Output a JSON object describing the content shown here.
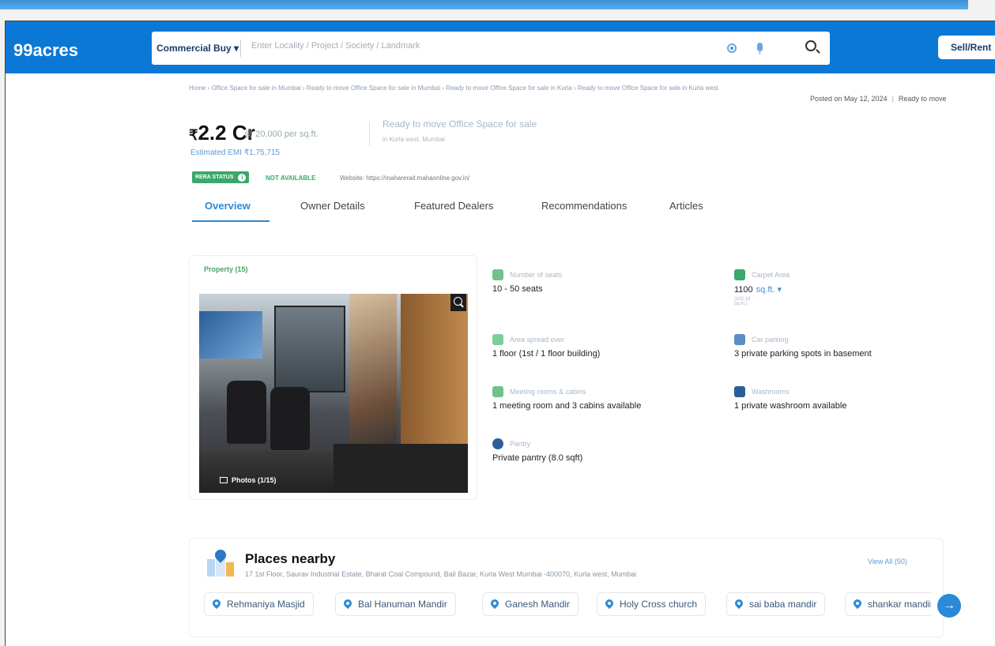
{
  "header": {
    "logo": "99acres",
    "category": "Commercial Buy ▾",
    "search_placeholder": "Enter Locality / Project / Society / Landmark",
    "sell_rent": "Sell/Rent"
  },
  "breadcrumb": "Home › Office Space for sale in Mumbai › Ready to move Office Space for sale in Mumbai › Ready to move Office Space for sale in Kurla › Ready to move Office Space for sale in Kurla west",
  "posted": {
    "date": "Posted on May 12, 2024",
    "status": "Ready to move"
  },
  "price": {
    "symbol": "₹",
    "amount": "2.2 Cr",
    "per_sqft": "@ 20,000 per sq.ft.",
    "emi": "Estimated EMI ₹1,75,715"
  },
  "property": {
    "title": "Ready to move Office Space for sale",
    "location": "in Kurla west, Mumbai"
  },
  "rera": {
    "status_label": "RERA STATUS",
    "value": "NOT AVAILABLE",
    "website": "Website: https://maharerait.mahaonline.gov.in/"
  },
  "tabs": [
    "Overview",
    "Owner Details",
    "Featured Dealers",
    "Recommendations",
    "Articles"
  ],
  "gallery": {
    "tab": "Property (15)",
    "photos": "Photos (1/15)"
  },
  "features": {
    "seats": {
      "label": "Number of seats",
      "value": "10 - 50 seats"
    },
    "carpet": {
      "label": "Carpet Area",
      "value": "1100",
      "unit": "sq.ft. ▾",
      "sub": "(102.19 sq.m.)"
    },
    "floors": {
      "label": "Area spread over",
      "value": "1 floor (1st / 1 floor building)"
    },
    "parking": {
      "label": "Car parking",
      "value": "3 private parking spots in basement"
    },
    "meeting": {
      "label": "Meeting rooms & cabins",
      "value": "1 meeting room and 3 cabins available"
    },
    "washroom": {
      "label": "Washrooms",
      "value": "1 private washroom available"
    },
    "pantry": {
      "label": "Pantry",
      "value": "Private pantry (8.0 sqft)"
    }
  },
  "places": {
    "title": "Places nearby",
    "address": "17 1st Floor, Saurav Industrial Estate, Bharat Coal Compound, Bail Bazar, Kurla West Mumbai -400070, Kurla west, Mumbai",
    "view_all": "View All (50)",
    "items": [
      "Rehmaniya Masjid",
      "Bal Hanuman Mandir",
      "Ganesh Mandir",
      "Holy Cross church",
      "sai baba mandir",
      "shankar mandir"
    ],
    "next": "→"
  },
  "colors": {
    "brand": "#0b78d6",
    "accent": "#2b8ad8",
    "rera_green": "#3aa86b"
  }
}
